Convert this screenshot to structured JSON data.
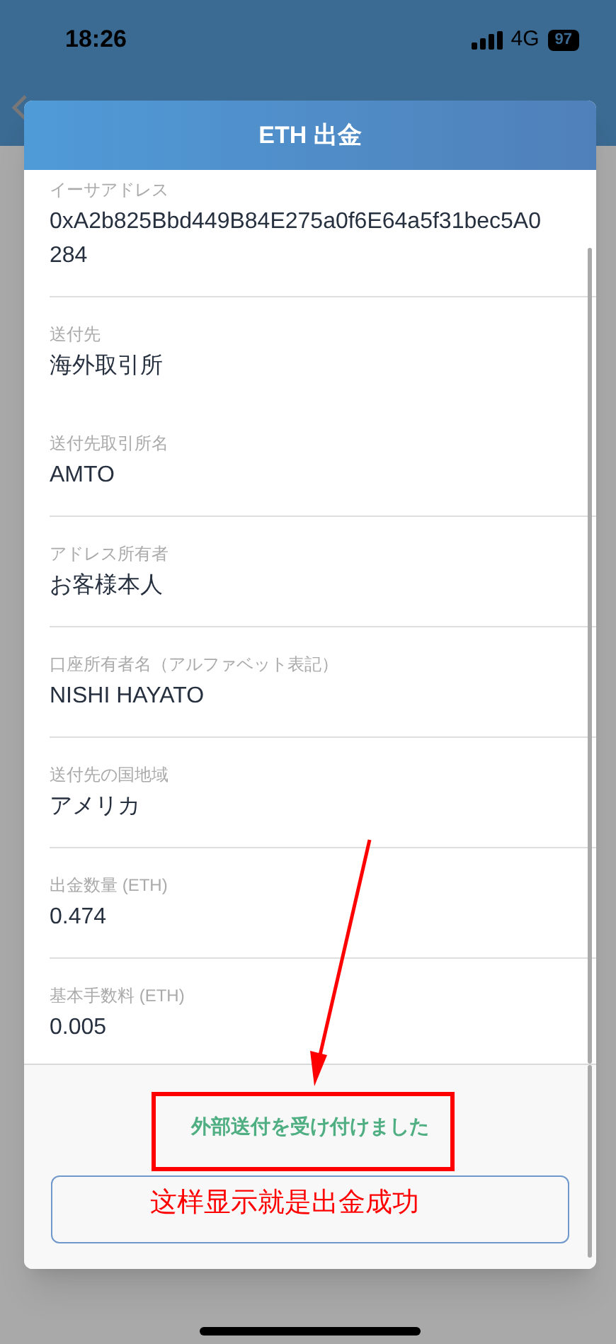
{
  "status_bar": {
    "time": "18:26",
    "network": "4G",
    "battery": "97"
  },
  "dialog": {
    "title": "ETH 出金",
    "fields": [
      {
        "label": "イーサアドレス",
        "value": "0xA2b825Bbd449B84E275a0f6E64a5f31bec5A0284",
        "divider": true
      },
      {
        "label": "送付先",
        "value": "海外取引所",
        "divider": false
      },
      {
        "label": "送付先取引所名",
        "value": "AMTO",
        "divider": true
      },
      {
        "label": "アドレス所有者",
        "value": "お客様本人",
        "divider": true
      },
      {
        "label": "口座所有者名（アルファベット表記）",
        "value": "NISHI HAYATO",
        "divider": true
      },
      {
        "label": "送付先の国地域",
        "value": "アメリカ",
        "divider": true
      },
      {
        "label": "出金数量 (ETH)",
        "value": "0.474",
        "divider": true
      },
      {
        "label": "基本手数料 (ETH)",
        "value": "0.005",
        "divider": false
      }
    ],
    "message": "外部送付を受け付けました"
  },
  "annotation": {
    "note": "这样显示就是出金成功"
  }
}
